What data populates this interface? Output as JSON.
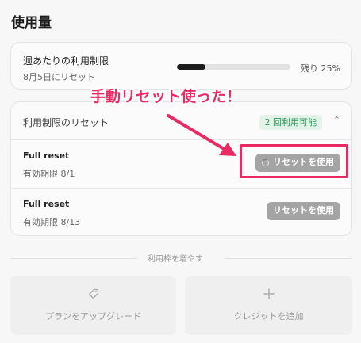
{
  "page": {
    "title": "使用量"
  },
  "weekly": {
    "title": "週あたりの利用制限",
    "reset_date": "8月5日にリセット",
    "usage_fraction": 0.25,
    "remaining_label": "残り 25%"
  },
  "annotation": {
    "text": "手動リセット使った！",
    "color": "#ea2a63"
  },
  "resets": {
    "header_label": "利用制限のリセット",
    "available_badge": "2 回利用可能",
    "rows": [
      {
        "name": "Full reset",
        "expiry": "有効期限 8/1",
        "button_label": "リセットを使用",
        "loading": true
      },
      {
        "name": "Full reset",
        "expiry": "有効期限 8/13",
        "button_label": "リセットを使用",
        "loading": false
      }
    ]
  },
  "increase": {
    "divider_text": "利用枠を増やす",
    "plan_label": "プランをアップグレード",
    "credit_label": "クレジットを追加",
    "plan_icon": "tag-icon",
    "credit_icon": "plus-icon"
  },
  "colors": {
    "accent": "#ea2a63",
    "badge_green": "#2a9a59",
    "button_gray": "#a4a4a4"
  }
}
